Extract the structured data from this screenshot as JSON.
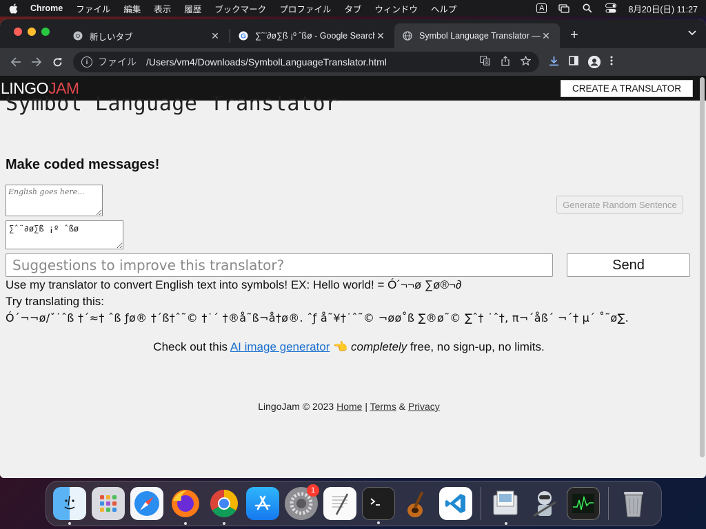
{
  "menubar": {
    "app_name": "Chrome",
    "items": [
      "ファイル",
      "編集",
      "表示",
      "履歴",
      "ブックマーク",
      "プロファイル",
      "タブ",
      "ウィンドウ",
      "ヘルプ"
    ],
    "ime": "A",
    "clock": "8月20日(日)  11:27"
  },
  "browser": {
    "tabs": [
      {
        "title": "新しいタブ"
      },
      {
        "title": "∑ˆ¨∂ø∑ß ¡º ˆßø - Google Search"
      },
      {
        "title": "Symbol Language Translator — Lingo"
      }
    ],
    "address": {
      "scheme": "ファイル",
      "url": "/Users/vm4/Downloads/SymbolLanguageTranslator.html"
    }
  },
  "site": {
    "logo_lingo": "LINGO",
    "logo_jam": "JAM",
    "create_button": "CREATE A TRANSLATOR",
    "page_title": "Symbol Language Translator",
    "subtitle": "Make coded messages!",
    "english_placeholder": "English goes here...",
    "output_value": "∑ˆ¨∂ø∑ß ¡º ˆßø",
    "generate_button": "Generate Random Sentence",
    "suggest_placeholder": "Suggestions to improve this translator?",
    "send_button": "Send",
    "description": "Use my translator to convert English text into symbols! EX: Hello world! = Ó´¬¬ø ∑ø®¬∂",
    "try_label": "Try translating this:",
    "try_symbols": "Ó´¬¬ø/ˇ˙ˆß †´≈† ˆß ƒø® †´ß†ˆ˜© †˙´ †®å˜ß¬å†ø®. ˆƒ å˜¥†˙ˆ˜© ¬øø˚ß ∑®ø˜© ∑ˆ† ˙ˆ†, π¬´åß´ ¬´† µ´ ˚˜ø∑.",
    "promo_pre": "Check out this ",
    "promo_link": "AI image generator",
    "promo_emoji": "👈",
    "promo_em": "completely",
    "promo_post": " free, no sign-up, no limits.",
    "footer_brand": "LingoJam © 2023 ",
    "footer_home": "Home",
    "footer_sep1": " | ",
    "footer_terms": "Terms",
    "footer_amp": " & ",
    "footer_privacy": "Privacy"
  },
  "dock": {
    "apps": [
      "finder-icon",
      "launchpad-icon",
      "safari-icon",
      "firefox-icon",
      "chrome-icon",
      "app-store-icon",
      "system-settings-icon",
      "textedit-icon",
      "terminal-icon",
      "garageband-icon",
      "vscode-icon",
      "preview-icon",
      "automator-icon",
      "activity-monitor-icon",
      "trash-icon"
    ],
    "settings_badge": "1"
  }
}
